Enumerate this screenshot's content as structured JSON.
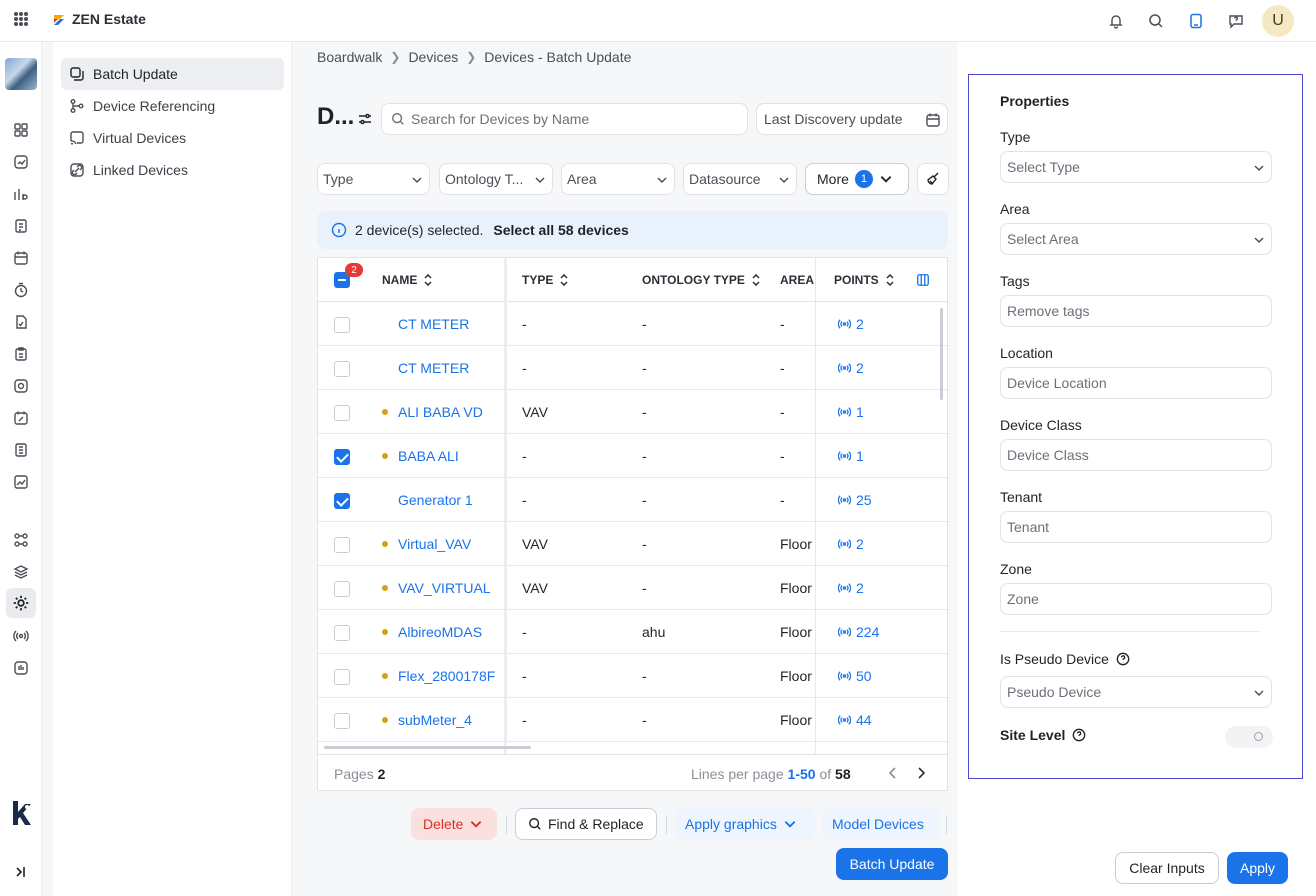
{
  "app": {
    "name": "ZEN Estate",
    "user_initial": "U"
  },
  "breadcrumb": [
    "Boardwalk",
    "Devices",
    "Devices - Batch Update"
  ],
  "submenu": [
    {
      "label": "Batch Update",
      "icon": "batch-update-icon",
      "active": true
    },
    {
      "label": "Device Referencing",
      "icon": "device-referencing-icon"
    },
    {
      "label": "Virtual Devices",
      "icon": "virtual-devices-icon"
    },
    {
      "label": "Linked Devices",
      "icon": "linked-devices-icon"
    }
  ],
  "toolbar": {
    "title": "D...",
    "search_placeholder": "Search for Devices by Name",
    "date_label": "Last Discovery update"
  },
  "filters": {
    "type": "Type",
    "ontology": "Ontology T...",
    "area": "Area",
    "datasource": "Datasource",
    "more": "More",
    "more_count": "1"
  },
  "selection": {
    "text": "2 device(s) selected.",
    "select_all": "Select all 58 devices",
    "count_badge": "2"
  },
  "table": {
    "headers": {
      "name": "NAME",
      "type": "TYPE",
      "ontology": "ONTOLOGY TYPE",
      "area": "AREA",
      "points": "POINTS"
    },
    "rows": [
      {
        "name": "CT METER",
        "type": "-",
        "ontology": "-",
        "area": "-",
        "points": "2",
        "checked": false,
        "dot": false
      },
      {
        "name": "CT METER",
        "type": "-",
        "ontology": "-",
        "area": "-",
        "points": "2",
        "checked": false,
        "dot": false
      },
      {
        "name": "ALI BABA VD",
        "type": "VAV",
        "ontology": "-",
        "area": "-",
        "points": "1",
        "checked": false,
        "dot": true
      },
      {
        "name": "BABA ALI",
        "type": "-",
        "ontology": "-",
        "area": "-",
        "points": "1",
        "checked": true,
        "dot": true
      },
      {
        "name": "Generator 1",
        "type": "-",
        "ontology": "-",
        "area": "-",
        "points": "25",
        "checked": true,
        "dot": false
      },
      {
        "name": "Virtual_VAV",
        "type": "VAV",
        "ontology": "-",
        "area": "Floor",
        "points": "2",
        "checked": false,
        "dot": true
      },
      {
        "name": "VAV_VIRTUAL",
        "type": "VAV",
        "ontology": "-",
        "area": "Floor",
        "points": "2",
        "checked": false,
        "dot": true
      },
      {
        "name": "AlbireoMDAS",
        "type": "-",
        "ontology": "ahu",
        "area": "Floor",
        "points": "224",
        "checked": false,
        "dot": true
      },
      {
        "name": "Flex_2800178F",
        "type": "-",
        "ontology": "-",
        "area": "Floor",
        "points": "50",
        "checked": false,
        "dot": true
      },
      {
        "name": "subMeter_4",
        "type": "-",
        "ontology": "-",
        "area": "Floor",
        "points": "44",
        "checked": false,
        "dot": true
      }
    ],
    "footer": {
      "pages_label": "Pages",
      "pages": "2",
      "lpp_label": "Lines per page",
      "range": "1-50",
      "of": "of",
      "total": "58"
    }
  },
  "actions": {
    "delete": "Delete",
    "find_replace": "Find & Replace",
    "apply_graphics": "Apply graphics",
    "model_devices": "Model Devices",
    "batch_update": "Batch Update"
  },
  "properties": {
    "title": "Properties",
    "type_label": "Type",
    "type_placeholder": "Select Type",
    "area_label": "Area",
    "area_placeholder": "Select Area",
    "tags_label": "Tags",
    "tags_placeholder": "Remove tags",
    "location_label": "Location",
    "location_placeholder": "Device Location",
    "class_label": "Device Class",
    "class_placeholder": "Device Class",
    "tenant_label": "Tenant",
    "tenant_placeholder": "Tenant",
    "zone_label": "Zone",
    "zone_placeholder": "Zone",
    "pseudo_label": "Is Pseudo Device",
    "pseudo_placeholder": "Pseudo Device",
    "site_label": "Site Level",
    "clear": "Clear Inputs",
    "apply": "Apply"
  },
  "colors": {
    "accent": "#1a73e8",
    "panel_border": "#4b45d6",
    "danger": "#d93025",
    "dot": "#d4a017"
  }
}
